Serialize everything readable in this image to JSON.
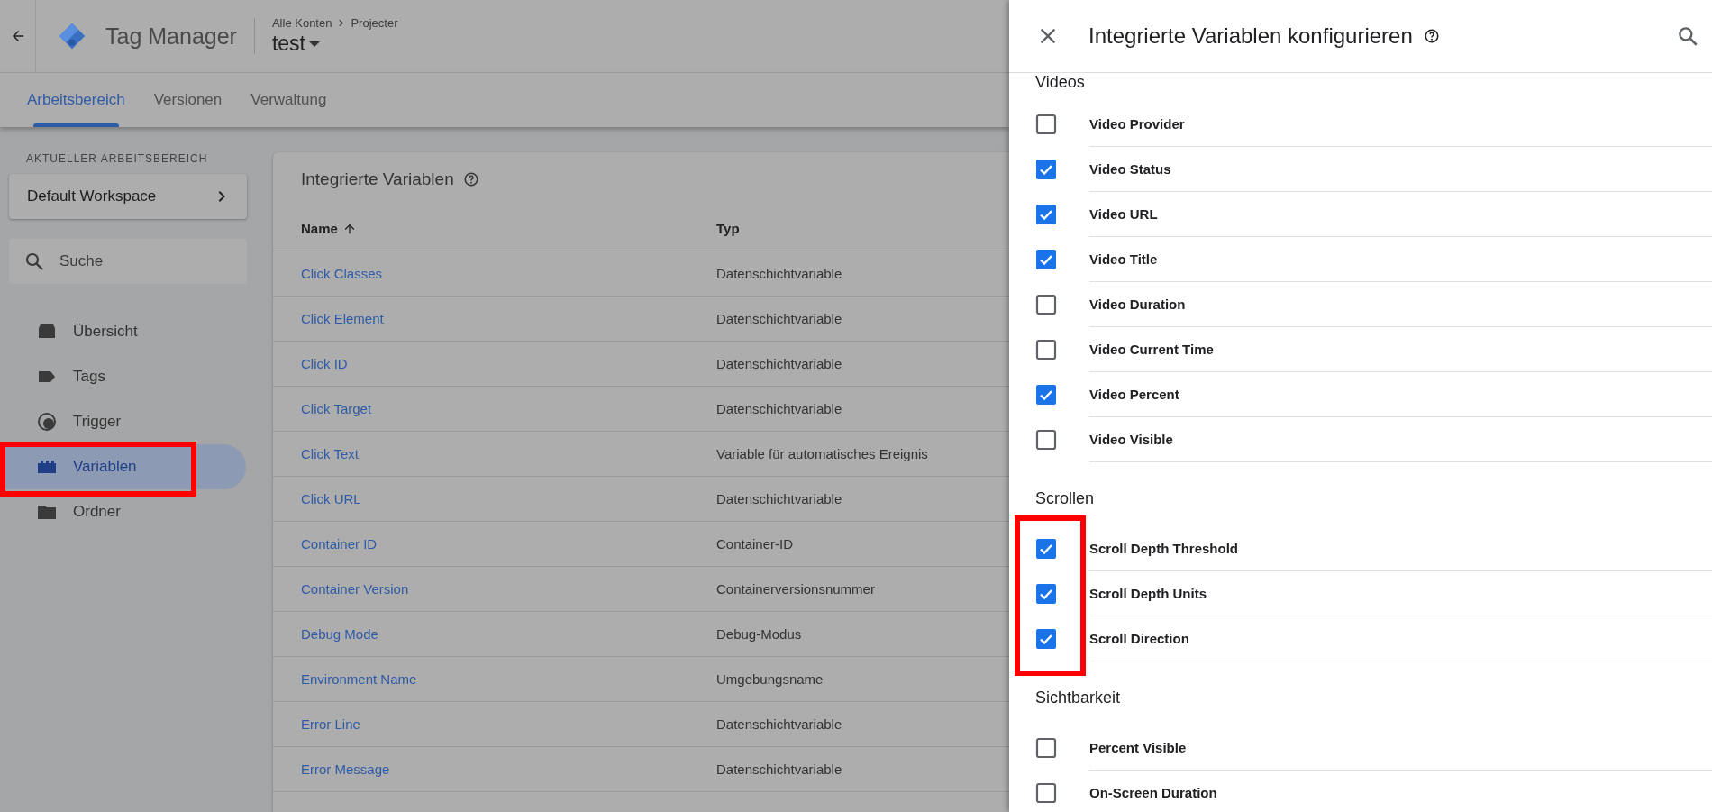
{
  "app": {
    "title": "Tag Manager",
    "breadcrumb": [
      "Alle Konten",
      "Projecter"
    ],
    "container": "test"
  },
  "tabs": [
    {
      "label": "Arbeitsbereich",
      "selected": true
    },
    {
      "label": "Versionen",
      "selected": false
    },
    {
      "label": "Verwaltung",
      "selected": false
    }
  ],
  "sidebar": {
    "workspace_label": "AKTUELLER ARBEITSBEREICH",
    "workspace": "Default Workspace",
    "search": {
      "placeholder": "Suche"
    },
    "items": [
      {
        "label": "Übersicht",
        "selected": false,
        "highlighted": false
      },
      {
        "label": "Tags",
        "selected": false,
        "highlighted": false
      },
      {
        "label": "Trigger",
        "selected": false,
        "highlighted": false
      },
      {
        "label": "Variablen",
        "selected": true,
        "highlighted": true
      },
      {
        "label": "Ordner",
        "selected": false,
        "highlighted": false
      }
    ]
  },
  "table": {
    "title": "Integrierte Variablen",
    "columns": [
      "Name",
      "Typ"
    ],
    "rows": [
      [
        "Click Classes",
        "Datenschichtvariable"
      ],
      [
        "Click Element",
        "Datenschichtvariable"
      ],
      [
        "Click ID",
        "Datenschichtvariable"
      ],
      [
        "Click Target",
        "Datenschichtvariable"
      ],
      [
        "Click Text",
        "Variable für automatisches Ereignis"
      ],
      [
        "Click URL",
        "Datenschichtvariable"
      ],
      [
        "Container ID",
        "Container-ID"
      ],
      [
        "Container Version",
        "Containerversionsnummer"
      ],
      [
        "Debug Mode",
        "Debug-Modus"
      ],
      [
        "Environment Name",
        "Umgebungsname"
      ],
      [
        "Error Line",
        "Datenschichtvariable"
      ],
      [
        "Error Message",
        "Datenschichtvariable"
      ]
    ]
  },
  "panel": {
    "title": "Integrierte Variablen konfigurieren",
    "sections": [
      {
        "title": "Videos",
        "highlighted": false,
        "items": [
          {
            "label": "Video Provider",
            "checked": false
          },
          {
            "label": "Video Status",
            "checked": true
          },
          {
            "label": "Video URL",
            "checked": true
          },
          {
            "label": "Video Title",
            "checked": true
          },
          {
            "label": "Video Duration",
            "checked": false
          },
          {
            "label": "Video Current Time",
            "checked": false
          },
          {
            "label": "Video Percent",
            "checked": true
          },
          {
            "label": "Video Visible",
            "checked": false
          }
        ]
      },
      {
        "title": "Scrollen",
        "highlighted": true,
        "items": [
          {
            "label": "Scroll Depth Threshold",
            "checked": true
          },
          {
            "label": "Scroll Depth Units",
            "checked": true
          },
          {
            "label": "Scroll Direction",
            "checked": true
          }
        ]
      },
      {
        "title": "Sichtbarkeit",
        "highlighted": false,
        "items": [
          {
            "label": "Percent Visible",
            "checked": false
          },
          {
            "label": "On-Screen Duration",
            "checked": false
          }
        ]
      }
    ]
  }
}
